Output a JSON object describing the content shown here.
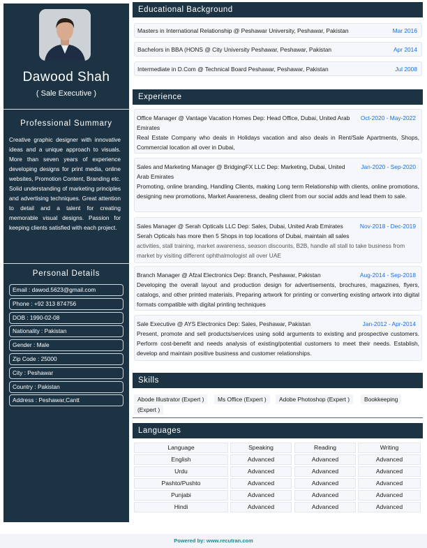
{
  "profile": {
    "name": "Dawood Shah",
    "role": "( Sale Executive )"
  },
  "summary": {
    "title": "Professional Summary",
    "text": "Creative graphic designer with innovative ideas and a unique approach to visuals. More than seven years of experience developing designs for print media, online websites, Promotion Content, Branding etc. Solid understanding of marketing principles and advertising techniques. Great attention to detail and a talent for creating memorable visual designs. Passion for keeping clients satisfied with each project."
  },
  "personal": {
    "title": "Personal Details",
    "items": [
      "Email : dawod.5623@gmail.com",
      "Phone : +92 313  874756",
      "DOB : 1990-02-08",
      "Nationality : Pakistan",
      "Gender : Male",
      "Zip Code : 25000",
      "City : Peshawar",
      "Country : Pakistan",
      "Address : Peshawar,Cantt"
    ]
  },
  "education": {
    "title": "Educational Background",
    "items": [
      {
        "text": "Masters   in International Relationship     @ Peshawar University, Peshawar, Pakistan",
        "date": "Mar 2016"
      },
      {
        "text": "Bachelors   in BBA (HONS    @ City University Peshawar, Peshawar, Pakistan",
        "date": "Apr 2014"
      },
      {
        "text": "Intermediate   in D.Com  @ Technical Board Peshawar, Peshawar, Pakistan",
        "date": "Jul 2008"
      }
    ]
  },
  "experience": {
    "title": "Experience",
    "items": [
      {
        "head": "Office Manager    @  Vantage Vacation Homes     Dep: Head Office, Dubai, United Arab Emirates",
        "date": "Oct-2020 - May-2022",
        "desc": "Real Estate Company who deals in Holidays vacation and also deals in Rent/Sale Apartments, Shops, Commercial location all over in Dubai,",
        "desc2": ""
      },
      {
        "head": "Sales and Marketing Manager     @  BridgingFX LLC    Dep: Marketing, Dubai, United Arab Emirates",
        "date": "Jan-2020 - Sep-2020",
        "desc": "Promoting, online branding, Handling Clients, making Long term Relationship with clients, online promotions, designing new promotions, Market Awareness, dealing client from our social adds and lead them to sale.",
        "desc2": ""
      },
      {
        "head": "Sales Manager    @  Serah Opticals LLC     Dep: Sales, Dubai, United Arab Emirates",
        "date": "Nov-2018 - Dec-2019",
        "desc": "Serah Opticals has more then 5 Shops in top locations of Dubai, maintain all sales",
        "desc2": "activities, stall training, market awareness, season discounts, B2B, handle all stall to take business from market by visiting different ophthalmologist all over UAE"
      },
      {
        "head": "Branch Manager   @  Afzal Electronics     Dep: Branch, Peshawar, Pakistan",
        "date": "Aug-2014 - Sep-2018",
        "desc": "Developing the overall layout and production design for advertisements, brochures, magazines, flyers, catalogs, and other printed materials. Preparing artwork for printing or converting existing artwork into digital formats compatible with digital printing techniques",
        "desc2": ""
      },
      {
        "head": "Sale Executive    @  AYS Electronics     Dep: Sales, Peshawar, Pakistan",
        "date": "Jan-2012 - Apr-2014",
        "desc": "Present, promote and sell products/services using solid arguments to existing and prospective customers. Perform cost-benefit and needs analysis of existing/potential customers to meet their needs. Establish, develop and maintain positive business and customer relationships.",
        "desc2": ""
      }
    ]
  },
  "skills": {
    "title": "Skills",
    "items": [
      "Abode Illustrator (Expert )",
      "Ms Office (Expert )",
      "Adobe Photoshop (Expert )",
      "Bookkeeping",
      "(Expert )"
    ]
  },
  "languages": {
    "title": "Languages",
    "headers": [
      "Language",
      "Speaking",
      "Reading",
      "Writing"
    ],
    "rows": [
      [
        "English",
        "Advanced",
        "Advanced",
        "Advanced"
      ],
      [
        "Urdu",
        "Advanced",
        "Advanced",
        "Advanced"
      ],
      [
        "Pashto/Pushto",
        "Advanced",
        "Advanced",
        "Advanced"
      ],
      [
        "Punjabi",
        "Advanced",
        "Advanced",
        "Advanced"
      ],
      [
        "Hindi",
        "Advanced",
        "Advanced",
        "Advanced"
      ]
    ]
  },
  "footer": "Powered by: www.recutran.com",
  "colors": {
    "sidebar": "#1c3344",
    "accent": "#1a6fe0",
    "footer": "#128a96"
  }
}
